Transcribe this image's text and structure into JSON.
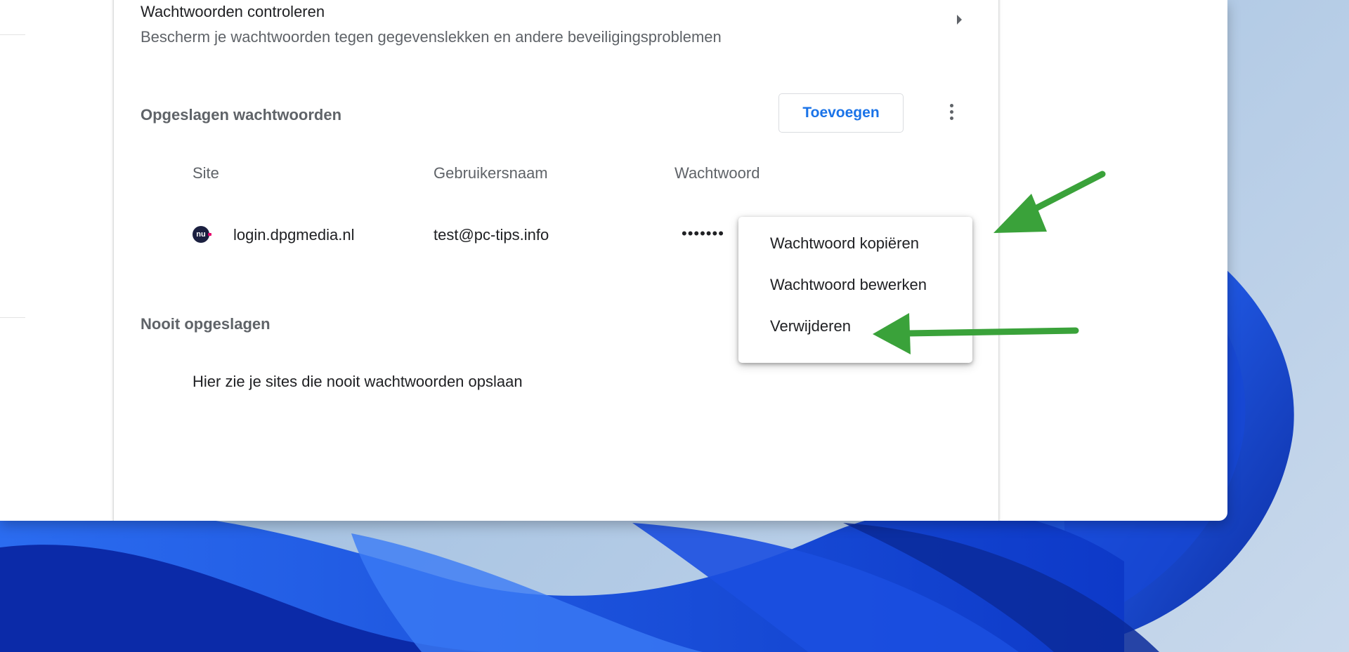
{
  "password_check": {
    "title": "Wachtwoorden controleren",
    "subtitle": "Bescherm je wachtwoorden tegen gegevenslekken en andere beveiligingsproblemen"
  },
  "saved_passwords": {
    "title": "Opgeslagen wachtwoorden",
    "add_label": "Toevoegen",
    "columns": {
      "site": "Site",
      "username": "Gebruikersnaam",
      "password": "Wachtwoord"
    },
    "rows": [
      {
        "site_icon": "nu",
        "site": "login.dpgmedia.nl",
        "username": "test@pc-tips.info",
        "password": "•••••••"
      }
    ]
  },
  "never_saved": {
    "title": "Nooit opgeslagen",
    "empty_text": "Hier zie je sites die nooit wachtwoorden opslaan"
  },
  "context_menu": {
    "items": [
      "Wachtwoord kopiëren",
      "Wachtwoord bewerken",
      "Verwijderen"
    ]
  },
  "colors": {
    "accent": "#1a73e8",
    "annotation_arrow": "#3aa23a",
    "secondary_text": "#5f6368"
  }
}
